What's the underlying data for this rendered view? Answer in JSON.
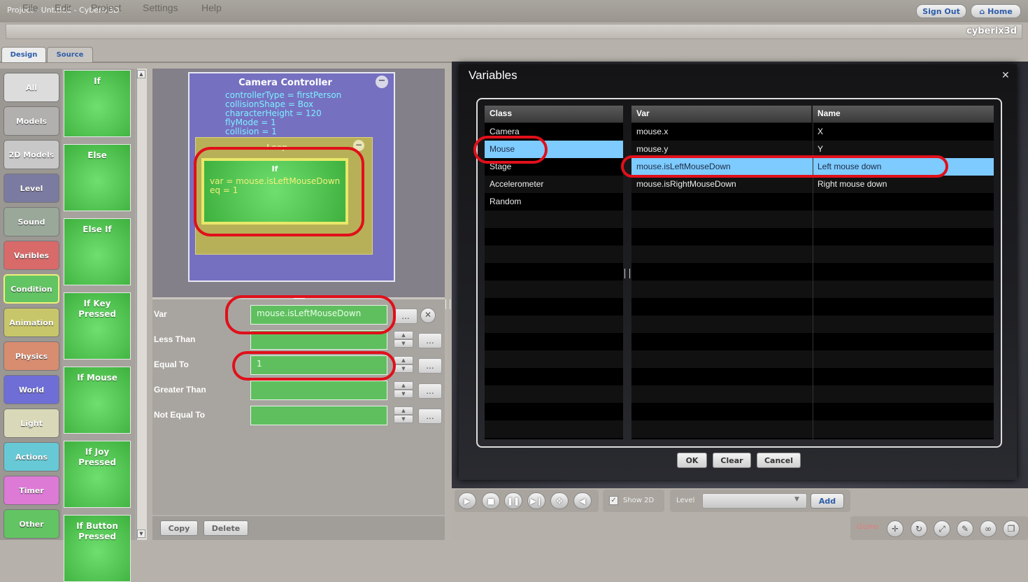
{
  "window": {
    "title": "Project - Untitled - Cyberix3D"
  },
  "top_buttons": {
    "sign_out": "Sign Out",
    "home": "Home"
  },
  "menu": {
    "items": [
      "File",
      "Edit",
      "Project",
      "Settings",
      "Help"
    ],
    "brand": "cyberix3d"
  },
  "tabs": [
    {
      "label": "Design",
      "active": true
    },
    {
      "label": "Source",
      "active": false
    }
  ],
  "categories": [
    {
      "label": "All",
      "color": "#dcdcdc"
    },
    {
      "label": "Models",
      "color": "#b1b0ae"
    },
    {
      "label": "2D Models",
      "color": "#c8c8c8"
    },
    {
      "label": "Level",
      "color": "#7b7aa0"
    },
    {
      "label": "Sound",
      "color": "#9aa89a"
    },
    {
      "label": "Varibles",
      "color": "#d86a6a"
    },
    {
      "label": "Condition",
      "color": "#63c463",
      "selected": true
    },
    {
      "label": "Animation",
      "color": "#c8c66a"
    },
    {
      "label": "Physics",
      "color": "#d88c70"
    },
    {
      "label": "World",
      "color": "#6e6ed6"
    },
    {
      "label": "Light",
      "color": "#d9d8b8"
    },
    {
      "label": "Actions",
      "color": "#67c9d6"
    },
    {
      "label": "Timer",
      "color": "#dd7ad6"
    },
    {
      "label": "Other",
      "color": "#63c463"
    }
  ],
  "palette_blocks": [
    "If",
    "Else",
    "Else If",
    "If Key Pressed",
    "If Mouse",
    "If Joy Pressed",
    "If Button Pressed"
  ],
  "canvas": {
    "camera_block": {
      "title": "Camera Controller",
      "props": [
        {
          "key": "controllerType",
          "value": "firstPerson"
        },
        {
          "key": "collisionShape",
          "value": "Box"
        },
        {
          "key": "characterHeight",
          "value": "120"
        },
        {
          "key": "flyMode",
          "value": "1"
        },
        {
          "key": "collision",
          "value": "1"
        }
      ]
    },
    "loop_block": {
      "title": "Loop"
    },
    "if_block": {
      "title": "If",
      "line1": "var = mouse.isLeftMouseDown",
      "line2": "eq = 1"
    }
  },
  "properties": {
    "var": {
      "label": "Var",
      "value": "mouse.isLeftMouseDown"
    },
    "less_than": {
      "label": "Less Than",
      "value": ""
    },
    "equal_to": {
      "label": "Equal To",
      "value": "1"
    },
    "greater_than": {
      "label": "Greater Than",
      "value": ""
    },
    "not_equal_to": {
      "label": "Not Equal To",
      "value": ""
    },
    "ellipsis": "...",
    "copy": "Copy",
    "delete": "Delete"
  },
  "dialog": {
    "title": "Variables",
    "class_header": "Class",
    "var_header": "Var",
    "name_header": "Name",
    "classes": [
      "Camera",
      "Mouse",
      "Stage",
      "Accelerometer",
      "Random"
    ],
    "selected_class": "Mouse",
    "vars": [
      {
        "var": "mouse.x",
        "name": "X"
      },
      {
        "var": "mouse.y",
        "name": "Y"
      },
      {
        "var": "mouse.isLeftMouseDown",
        "name": "Left mouse down",
        "selected": true
      },
      {
        "var": "mouse.isRightMouseDown",
        "name": "Right mouse down"
      }
    ],
    "ok": "OK",
    "clear": "Clear",
    "cancel": "Cancel"
  },
  "transport": {
    "show2d": "Show 2D",
    "level_label": "Level",
    "add": "Add",
    "gizmo": "Gizmo"
  }
}
